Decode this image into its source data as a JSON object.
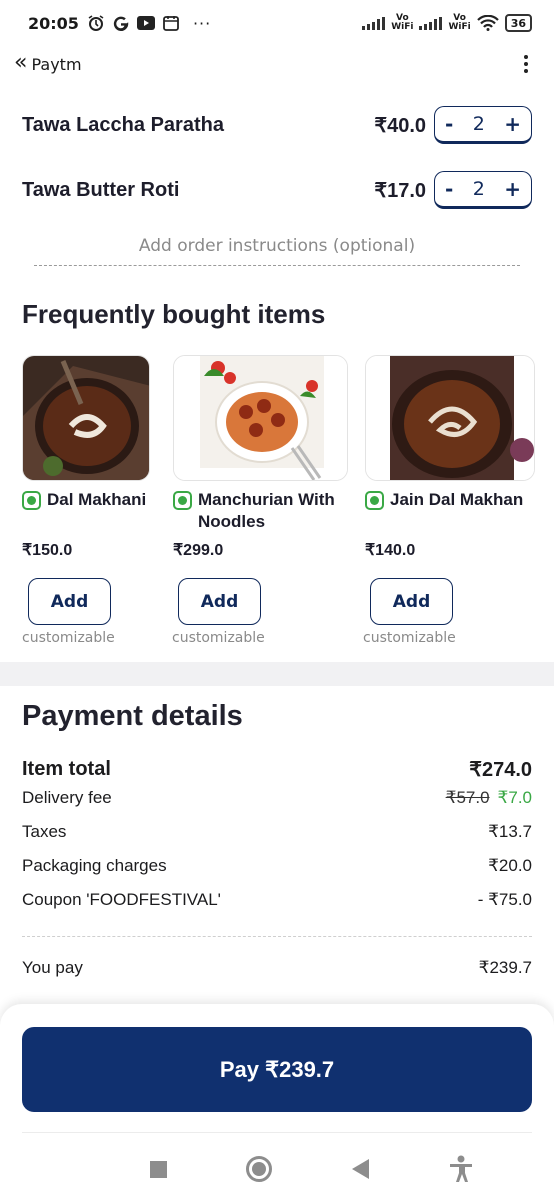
{
  "status_bar": {
    "time": "20:05",
    "vo_top": "Vo",
    "vo_bottom": "WiFi",
    "battery": "36"
  },
  "header": {
    "back_label": "Paytm"
  },
  "cart": {
    "items": [
      {
        "name": "Tawa Laccha Paratha",
        "price": "₹40.0",
        "qty": "2"
      },
      {
        "name": "Tawa Butter Roti",
        "price": "₹17.0",
        "qty": "2"
      }
    ],
    "minus": "-",
    "plus": "+",
    "instructions_placeholder": "Add order instructions (optional)"
  },
  "frequently_bought": {
    "title": "Frequently bought items",
    "add_label": "Add",
    "customizable_label": "customizable",
    "items": [
      {
        "name": "Dal Makhani",
        "price": "₹150.0"
      },
      {
        "name": "Manchurian With Noodles",
        "name_line1": "Manchurian With",
        "name_line2": "Noodles",
        "price": "₹299.0"
      },
      {
        "name": "Jain Dal Makhani",
        "name_visible": "Jain Dal Makhan",
        "price": "₹140.0"
      }
    ]
  },
  "payment": {
    "title": "Payment details",
    "item_total_label": "Item total",
    "item_total_value": "₹274.0",
    "delivery_label": "Delivery fee",
    "delivery_original": "₹57.0",
    "delivery_value": "₹7.0",
    "taxes_label": "Taxes",
    "taxes_value": "₹13.7",
    "packaging_label": "Packaging charges",
    "packaging_value": "₹20.0",
    "coupon_label": "Coupon 'FOODFESTIVAL'",
    "coupon_value": "- ₹75.0",
    "you_pay_label": "You pay",
    "you_pay_value": "₹239.7"
  },
  "pay_button": {
    "label": "Pay ₹239.7"
  },
  "colors": {
    "brand_navy": "#10306f",
    "veg_green": "#3aa845",
    "stepper_navy": "#10295b"
  }
}
